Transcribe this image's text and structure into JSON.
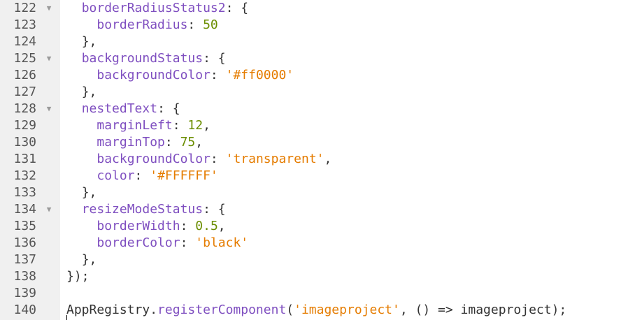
{
  "editor": {
    "fold_icon": "fold-arrow-icon",
    "colors": {
      "key": "#7f4fc0",
      "number": "#6b8e00",
      "string": "#e57c00",
      "punctuation": "#333333",
      "gutter": "#f0f0f0"
    },
    "lines": [
      {
        "num": "122",
        "fold": true,
        "indent": "  ",
        "tokens": [
          {
            "t": "k",
            "v": "borderRadiusStatus2"
          },
          {
            "t": "p",
            "v": ": {"
          }
        ]
      },
      {
        "num": "123",
        "fold": false,
        "indent": "    ",
        "tokens": [
          {
            "t": "k",
            "v": "borderRadius"
          },
          {
            "t": "p",
            "v": ": "
          },
          {
            "t": "n",
            "v": "50"
          }
        ]
      },
      {
        "num": "124",
        "fold": false,
        "indent": "  ",
        "tokens": [
          {
            "t": "p",
            "v": "},"
          }
        ]
      },
      {
        "num": "125",
        "fold": true,
        "indent": "  ",
        "tokens": [
          {
            "t": "k",
            "v": "backgroundStatus"
          },
          {
            "t": "p",
            "v": ": {"
          }
        ]
      },
      {
        "num": "126",
        "fold": false,
        "indent": "    ",
        "tokens": [
          {
            "t": "k",
            "v": "backgroundColor"
          },
          {
            "t": "p",
            "v": ": "
          },
          {
            "t": "s",
            "v": "'#ff0000'"
          }
        ]
      },
      {
        "num": "127",
        "fold": false,
        "indent": "  ",
        "tokens": [
          {
            "t": "p",
            "v": "},"
          }
        ]
      },
      {
        "num": "128",
        "fold": true,
        "indent": "  ",
        "tokens": [
          {
            "t": "k",
            "v": "nestedText"
          },
          {
            "t": "p",
            "v": ": {"
          }
        ]
      },
      {
        "num": "129",
        "fold": false,
        "indent": "    ",
        "tokens": [
          {
            "t": "k",
            "v": "marginLeft"
          },
          {
            "t": "p",
            "v": ": "
          },
          {
            "t": "n",
            "v": "12"
          },
          {
            "t": "p",
            "v": ","
          }
        ]
      },
      {
        "num": "130",
        "fold": false,
        "indent": "    ",
        "tokens": [
          {
            "t": "k",
            "v": "marginTop"
          },
          {
            "t": "p",
            "v": ": "
          },
          {
            "t": "n",
            "v": "75"
          },
          {
            "t": "p",
            "v": ","
          }
        ]
      },
      {
        "num": "131",
        "fold": false,
        "indent": "    ",
        "tokens": [
          {
            "t": "k",
            "v": "backgroundColor"
          },
          {
            "t": "p",
            "v": ": "
          },
          {
            "t": "s",
            "v": "'transparent'"
          },
          {
            "t": "p",
            "v": ","
          }
        ]
      },
      {
        "num": "132",
        "fold": false,
        "indent": "    ",
        "tokens": [
          {
            "t": "k",
            "v": "color"
          },
          {
            "t": "p",
            "v": ": "
          },
          {
            "t": "s",
            "v": "'#FFFFFF'"
          }
        ]
      },
      {
        "num": "133",
        "fold": false,
        "indent": "  ",
        "tokens": [
          {
            "t": "p",
            "v": "},"
          }
        ]
      },
      {
        "num": "134",
        "fold": true,
        "indent": "  ",
        "tokens": [
          {
            "t": "k",
            "v": "resizeModeStatus"
          },
          {
            "t": "p",
            "v": ": {"
          }
        ]
      },
      {
        "num": "135",
        "fold": false,
        "indent": "    ",
        "tokens": [
          {
            "t": "k",
            "v": "borderWidth"
          },
          {
            "t": "p",
            "v": ": "
          },
          {
            "t": "n",
            "v": "0.5"
          },
          {
            "t": "p",
            "v": ","
          }
        ]
      },
      {
        "num": "136",
        "fold": false,
        "indent": "    ",
        "tokens": [
          {
            "t": "k",
            "v": "borderColor"
          },
          {
            "t": "p",
            "v": ": "
          },
          {
            "t": "s",
            "v": "'black'"
          }
        ]
      },
      {
        "num": "137",
        "fold": false,
        "indent": "  ",
        "tokens": [
          {
            "t": "p",
            "v": "},"
          }
        ]
      },
      {
        "num": "138",
        "fold": false,
        "indent": "",
        "tokens": [
          {
            "t": "p",
            "v": "});"
          }
        ]
      },
      {
        "num": "139",
        "fold": false,
        "indent": "",
        "tokens": []
      },
      {
        "num": "140",
        "fold": false,
        "indent": "",
        "tokens": [
          {
            "t": "p",
            "v": "AppRegistry."
          },
          {
            "t": "k",
            "v": "registerComponent"
          },
          {
            "t": "p",
            "v": "("
          },
          {
            "t": "s",
            "v": "'imageproject'"
          },
          {
            "t": "p",
            "v": ", () => imageproject);"
          }
        ]
      }
    ]
  }
}
